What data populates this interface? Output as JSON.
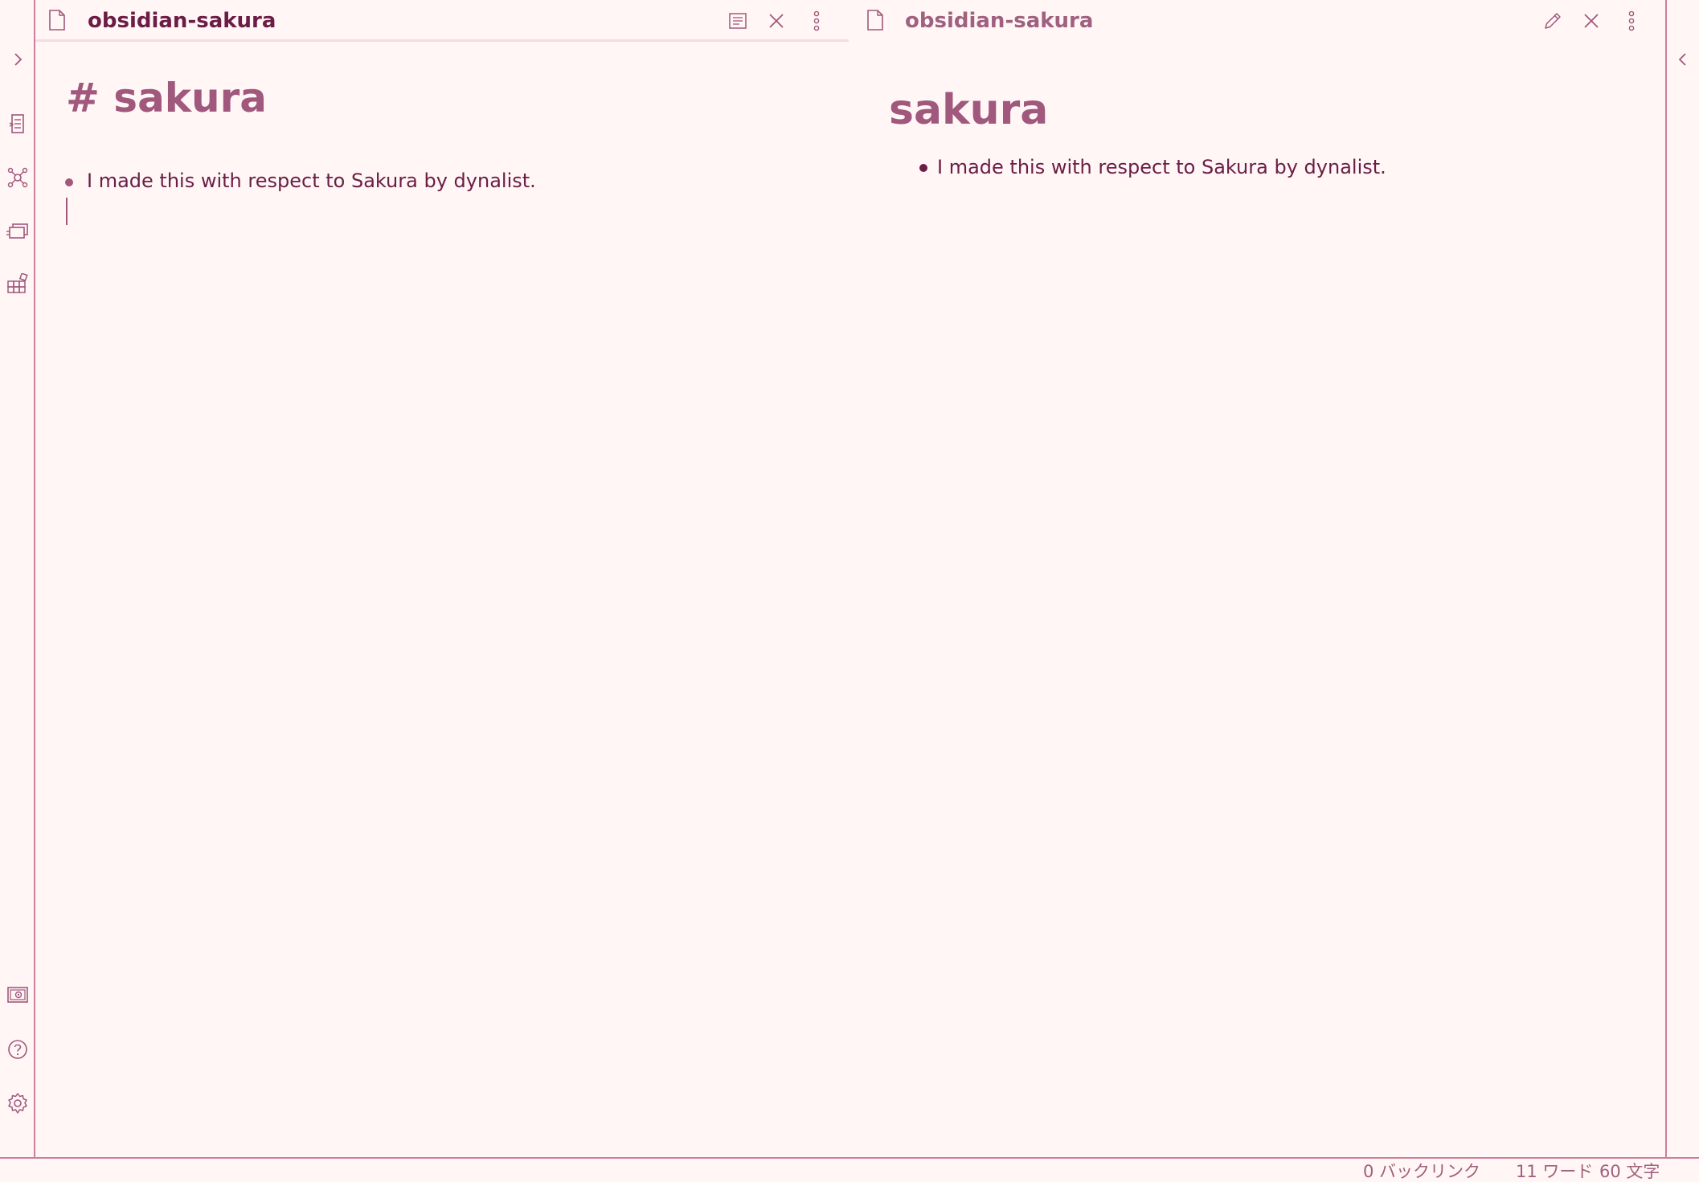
{
  "left_pane": {
    "title": "obsidian-sakura",
    "editor": {
      "heading": "# sakura",
      "bullet_text": "I made this with respect to Sakura by dynalist."
    },
    "actions": [
      "reading-view-icon",
      "close-icon",
      "more-options-icon"
    ]
  },
  "right_pane": {
    "title": "obsidian-sakura",
    "preview": {
      "heading": "sakura",
      "bullet_text": "I made this with respect to Sakura by dynalist."
    },
    "actions": [
      "edit-pencil-icon",
      "close-icon",
      "more-options-icon"
    ]
  },
  "ribbon_left": {
    "icons": [
      "expand-sidebar-icon",
      "quick-switcher-icon",
      "graph-view-icon",
      "slides-icon",
      "plugins-icon",
      "vault-icon",
      "help-icon",
      "settings-icon"
    ]
  },
  "ribbon_right": {
    "icons": [
      "collapse-sidebar-icon"
    ]
  },
  "status_bar": {
    "backlinks": "0 バックリンク",
    "words": "11 ワード",
    "chars": "60 文字"
  },
  "colors": {
    "background": "#fff6f5",
    "text": "#6b1d45",
    "accent": "#a0587d",
    "border": "#c9809f"
  }
}
